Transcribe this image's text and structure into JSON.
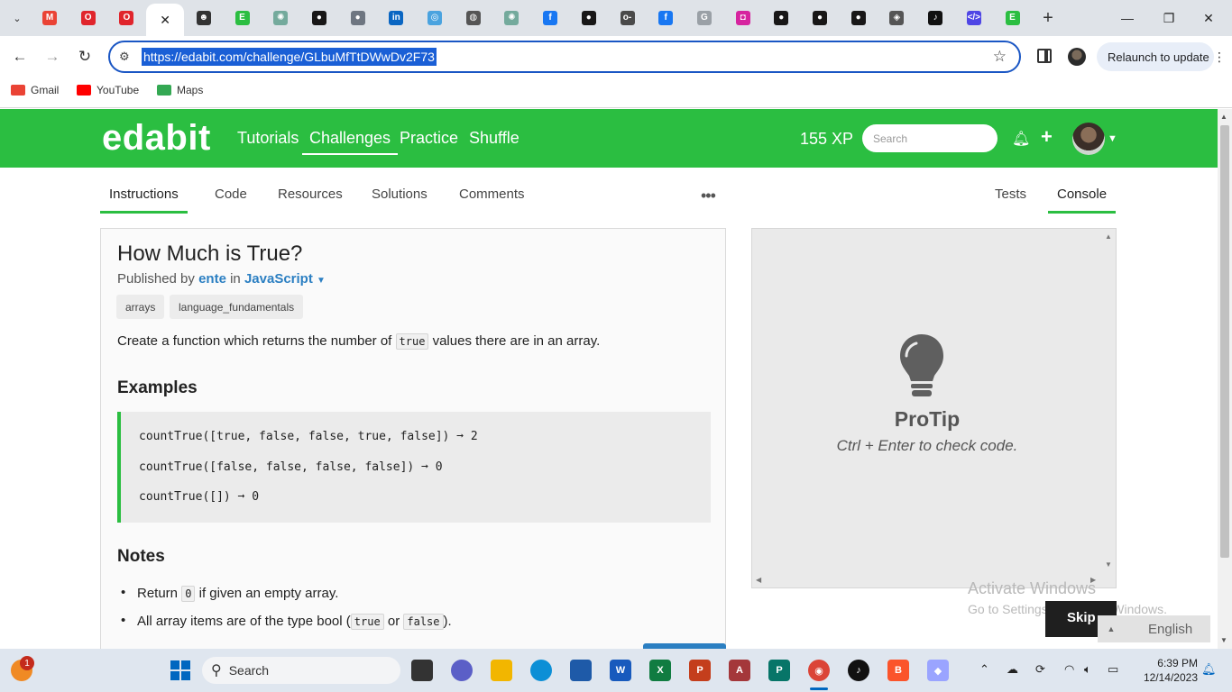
{
  "browser": {
    "url": "https://edabit.com/challenge/GLbuMfTtDWwDv2F73",
    "relaunch_label": "Relaunch to update",
    "tab_favicons": [
      {
        "name": "gmail-favicon",
        "color": "#ea4335",
        "glyph": "M"
      },
      {
        "name": "opera-favicon",
        "color": "#e0252c",
        "glyph": "O"
      },
      {
        "name": "opera-favicon-2",
        "color": "#e0252c",
        "glyph": "O"
      },
      {
        "name": "edabit-favicon-active",
        "color": "#222222",
        "glyph": "✕"
      },
      {
        "name": "profile-favicon",
        "color": "#333333",
        "glyph": "☻"
      },
      {
        "name": "edabit-favicon",
        "color": "#2bbe41",
        "glyph": "E"
      },
      {
        "name": "chatgpt-favicon",
        "color": "#74aa9c",
        "glyph": "✺"
      },
      {
        "name": "github-favicon",
        "color": "#181717",
        "glyph": "●"
      },
      {
        "name": "github-favicon-2",
        "color": "#6e7681",
        "glyph": "●"
      },
      {
        "name": "linkedin-favicon",
        "color": "#0a66c2",
        "glyph": "in"
      },
      {
        "name": "site-favicon",
        "color": "#4aa3df",
        "glyph": "◎"
      },
      {
        "name": "globe-favicon",
        "color": "#555555",
        "glyph": "◍"
      },
      {
        "name": "chatgpt-favicon-2",
        "color": "#74aa9c",
        "glyph": "✺"
      },
      {
        "name": "facebook-favicon",
        "color": "#1877f2",
        "glyph": "f"
      },
      {
        "name": "github-favicon-3",
        "color": "#181717",
        "glyph": "●"
      },
      {
        "name": "key-favicon",
        "color": "#4a4a4a",
        "glyph": "o-"
      },
      {
        "name": "facebook-favicon-2",
        "color": "#1877f2",
        "glyph": "f"
      },
      {
        "name": "google-favicon",
        "color": "#9aa0a6",
        "glyph": "G"
      },
      {
        "name": "instagram-favicon",
        "color": "#d6249f",
        "glyph": "◘"
      },
      {
        "name": "github-favicon-4",
        "color": "#181717",
        "glyph": "●"
      },
      {
        "name": "github-favicon-5",
        "color": "#181717",
        "glyph": "●"
      },
      {
        "name": "github-favicon-6",
        "color": "#181717",
        "glyph": "●"
      },
      {
        "name": "shield-favicon",
        "color": "#555555",
        "glyph": "◈"
      },
      {
        "name": "tiktok-favicon",
        "color": "#111111",
        "glyph": "♪"
      },
      {
        "name": "code-favicon",
        "color": "#4f46e5",
        "glyph": "</>"
      },
      {
        "name": "edabit-favicon-2",
        "color": "#2bbe41",
        "glyph": "E"
      }
    ]
  },
  "bookmarks": [
    {
      "label": "Gmail",
      "color": "#ea4335"
    },
    {
      "label": "YouTube",
      "color": "#ff0000"
    },
    {
      "label": "Maps",
      "color": "#34a853"
    }
  ],
  "site": {
    "brand": "edabit",
    "nav": [
      "Tutorials",
      "Challenges",
      "Practice",
      "Shuffle"
    ],
    "active_nav": "Challenges",
    "xp": "155 XP",
    "search_placeholder": "Search",
    "accent_color": "#2bbe41"
  },
  "page_tabs": {
    "left": [
      "Instructions",
      "Code",
      "Resources",
      "Solutions",
      "Comments"
    ],
    "right": [
      "Tests",
      "Console"
    ],
    "more": "•••"
  },
  "challenge": {
    "title": "How Much is True?",
    "published_prefix": "Published by",
    "author": "ente",
    "in_word": "in",
    "language": "JavaScript",
    "tags": [
      "arrays",
      "language_fundamentals"
    ],
    "desc_before": "Create a function which returns the number of",
    "desc_code": "true",
    "desc_after": "values there are in an array.",
    "examples_heading": "Examples",
    "examples": [
      "countTrue([true, false, false, true, false]) ➞ 2",
      "countTrue([false, false, false, false]) ➞ 0",
      "countTrue([]) ➞ 0"
    ],
    "notes_heading": "Notes",
    "note1_before": "Return",
    "note1_code": "0",
    "note1_after": "if given an empty array.",
    "note2_before": "All array items are of the type bool (",
    "note2_code1": "true",
    "note2_mid": "or",
    "note2_code2": "false",
    "note2_after": ")."
  },
  "console": {
    "protip_title": "ProTip",
    "protip_text": "Ctrl + Enter to check code."
  },
  "overlay": {
    "activate_title": "Activate Windows",
    "activate_sub": "Go to Settings to activate Windows.",
    "skip": "Skip",
    "language": "English"
  },
  "taskbar": {
    "search_label": "Search",
    "notification_count": "1",
    "time": "6:39 PM",
    "date": "12/14/2023"
  }
}
